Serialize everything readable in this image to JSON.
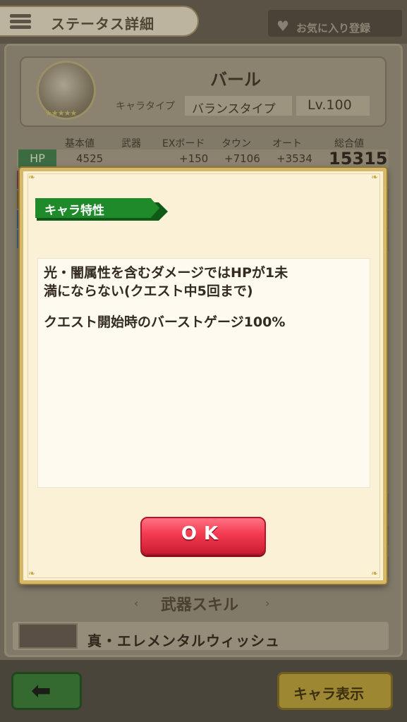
{
  "header": {
    "title": "ステータス詳細",
    "favorite_label": "お気に入り登録",
    "menu_icon": "hamburger-menu-icon",
    "favorite_icon": "heart-icon"
  },
  "character": {
    "name": "バール",
    "type_label": "キャラタイプ",
    "type_value": "バランスタイプ",
    "level": "Lv.100",
    "stars": "★★★★★"
  },
  "stats": {
    "headers": [
      "基本値",
      "武器",
      "EXボード",
      "タウン",
      "オート",
      "総合値"
    ],
    "hp": {
      "label": "HP",
      "base": "4525",
      "weapon": "",
      "exboard": "+150",
      "town": "+7106",
      "auto": "+3534",
      "total": "15315"
    }
  },
  "weapon_skill": {
    "header": "武器スキル",
    "name": "真・エレメンタルウィッシュ"
  },
  "footer": {
    "back_icon": "arrow-left-icon",
    "show_label": "キャラ表示"
  },
  "dialog": {
    "tag": "キャラ特性",
    "lines": [
      "光・闇属性を含むダメージではHPが1未",
      "満にならない(クエスト中5回まで)",
      "クエスト開始時のバーストゲージ100%"
    ],
    "ok_label": "OK"
  },
  "colors": {
    "dialog_bg": "#fbf1d6",
    "dialog_border": "#d7b869",
    "tag_green": "#1e8a2a",
    "ok_red": "#f33a50"
  }
}
